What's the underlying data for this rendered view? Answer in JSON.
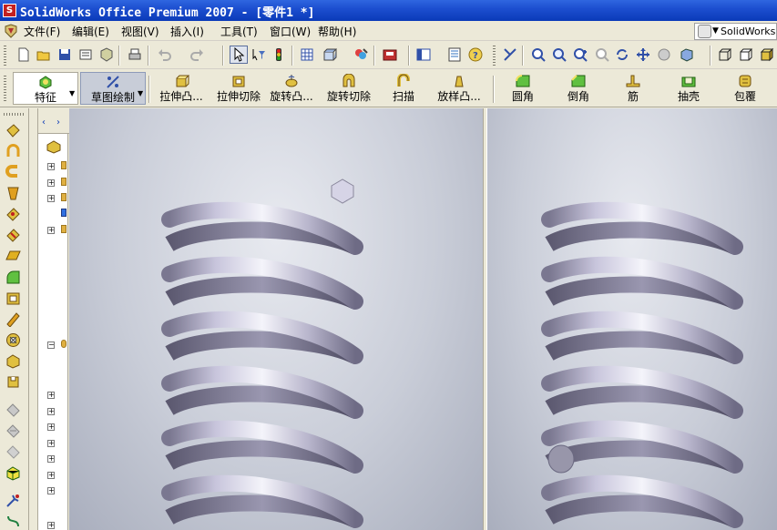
{
  "window": {
    "title": "SolidWorks Office Premium 2007 - [零件1 *]"
  },
  "menu": {
    "items": [
      "文件(F)",
      "编辑(E)",
      "视图(V)",
      "插入(I)",
      "工具(T)",
      "窗口(W)",
      "帮助(H)"
    ],
    "right_label": "SolidWorks"
  },
  "commands": {
    "feature": "特征",
    "sketch": "草图绘制",
    "items": [
      "拉伸凸...",
      "拉伸切除",
      "旋转凸...",
      "旋转切除",
      "扫描",
      "放样凸...",
      "圆角",
      "倒角",
      "筋",
      "抽壳",
      "包覆"
    ]
  },
  "tree": {
    "tabs": [
      "‹",
      "›"
    ]
  },
  "colors": {
    "title_bar": "#1d4fd0",
    "chrome": "#ece9d8",
    "viewport_bg": "#c9cdd8",
    "spring": "#b8b4c8"
  }
}
